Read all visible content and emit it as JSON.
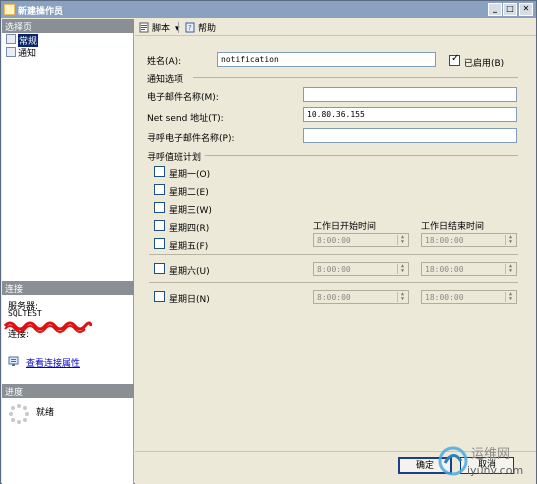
{
  "window": {
    "title": "新建操作员"
  },
  "leftpanel": {
    "select_page_header": "选择页",
    "nav_items": [
      {
        "label": "常规"
      },
      {
        "label": "通知"
      }
    ],
    "connection_header": "连接",
    "server_label": "服务器:",
    "server_value": "SQLTEST",
    "connection_label": "连接:",
    "view_connection_link": "查看连接属性",
    "progress_header": "进度",
    "progress_status": "就绪"
  },
  "toolbar": {
    "script_label": "脚本",
    "help_label": "帮助"
  },
  "form": {
    "name_label": "姓名(A):",
    "name_value": "notification",
    "enabled_label": "已启用(B)",
    "enabled_checked": true,
    "notify_section": "通知选项",
    "email_label": "电子邮件名称(M):",
    "email_value": "",
    "netsend_label": "Net send 地址(T):",
    "netsend_value": "10.80.36.155",
    "pager_label": "寻呼电子邮件名称(P):",
    "pager_value": "",
    "schedule_section": "寻呼值班计划",
    "weekdays": [
      {
        "label": "星期一(O)"
      },
      {
        "label": "星期二(E)"
      },
      {
        "label": "星期三(W)"
      },
      {
        "label": "星期四(R)"
      },
      {
        "label": "星期五(F)"
      }
    ],
    "saturday_label": "星期六(U)",
    "sunday_label": "星期日(N)",
    "workday_start_label": "工作日开始时间",
    "workday_end_label": "工作日结束时间",
    "start_time": "8:00:00",
    "end_time": "18:00:00"
  },
  "buttons": {
    "ok": "确定",
    "cancel": "取消"
  },
  "watermark": {
    "text": "运维网",
    "url": "iyunv.com"
  }
}
